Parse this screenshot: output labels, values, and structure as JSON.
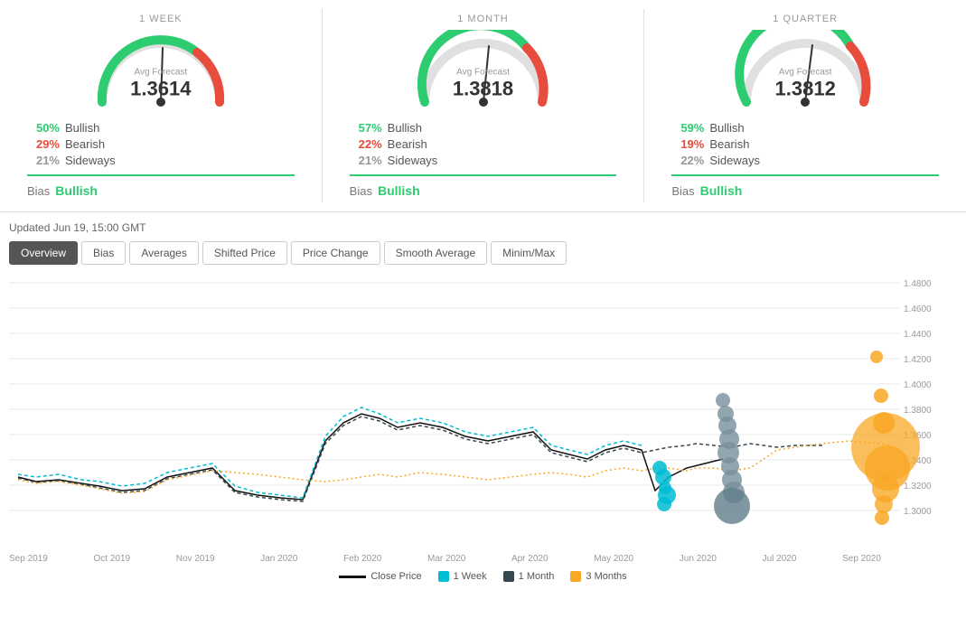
{
  "forecasts": [
    {
      "period": "1 WEEK",
      "avg_label": "Avg Forecast",
      "avg_value": "1.3614",
      "bull_pct": "50%",
      "bear_pct": "29%",
      "side_pct": "21%",
      "bias": "Bullish",
      "gauge_green": 150,
      "gauge_red": 30
    },
    {
      "period": "1 MONTH",
      "avg_label": "Avg Forecast",
      "avg_value": "1.3818",
      "bull_pct": "57%",
      "bear_pct": "22%",
      "side_pct": "21%",
      "bias": "Bullish",
      "gauge_green": 160,
      "gauge_red": 20
    },
    {
      "period": "1 QUARTER",
      "avg_label": "Avg Forecast",
      "avg_value": "1.3812",
      "bull_pct": "59%",
      "bear_pct": "19%",
      "side_pct": "22%",
      "bias": "Bullish",
      "gauge_green": 165,
      "gauge_red": 15
    }
  ],
  "updated_text": "Updated Jun 19, 15:00 GMT",
  "tabs": [
    {
      "label": "Overview",
      "active": true
    },
    {
      "label": "Bias",
      "active": false
    },
    {
      "label": "Averages",
      "active": false
    },
    {
      "label": "Shifted Price",
      "active": false
    },
    {
      "label": "Price Change",
      "active": false
    },
    {
      "label": "Smooth Average",
      "active": false
    },
    {
      "label": "Minim/Max",
      "active": false
    }
  ],
  "y_axis": [
    "1.4800",
    "1.4600",
    "1.4400",
    "1.4200",
    "1.4000",
    "1.3800",
    "1.3600",
    "1.3400",
    "1.3200",
    "1.3000"
  ],
  "x_axis": [
    "Sep 2019",
    "Oct 2019",
    "Nov 2019",
    "Jan 2020",
    "Feb 2020",
    "Mar 2020",
    "Apr 2020",
    "May 2020",
    "Jun 2020",
    "Jul 2020",
    "Sep 2020"
  ],
  "legend": [
    {
      "label": "Close Price",
      "color": "#111111"
    },
    {
      "label": "1 Week",
      "color": "#00bcd4"
    },
    {
      "label": "1 Month",
      "color": "#37474f"
    },
    {
      "label": "3 Months",
      "color": "#f9a825"
    }
  ],
  "colors": {
    "bullish": "#2ecc71",
    "bearish": "#e74c3c",
    "sideways": "#999999",
    "accent": "#555555"
  }
}
